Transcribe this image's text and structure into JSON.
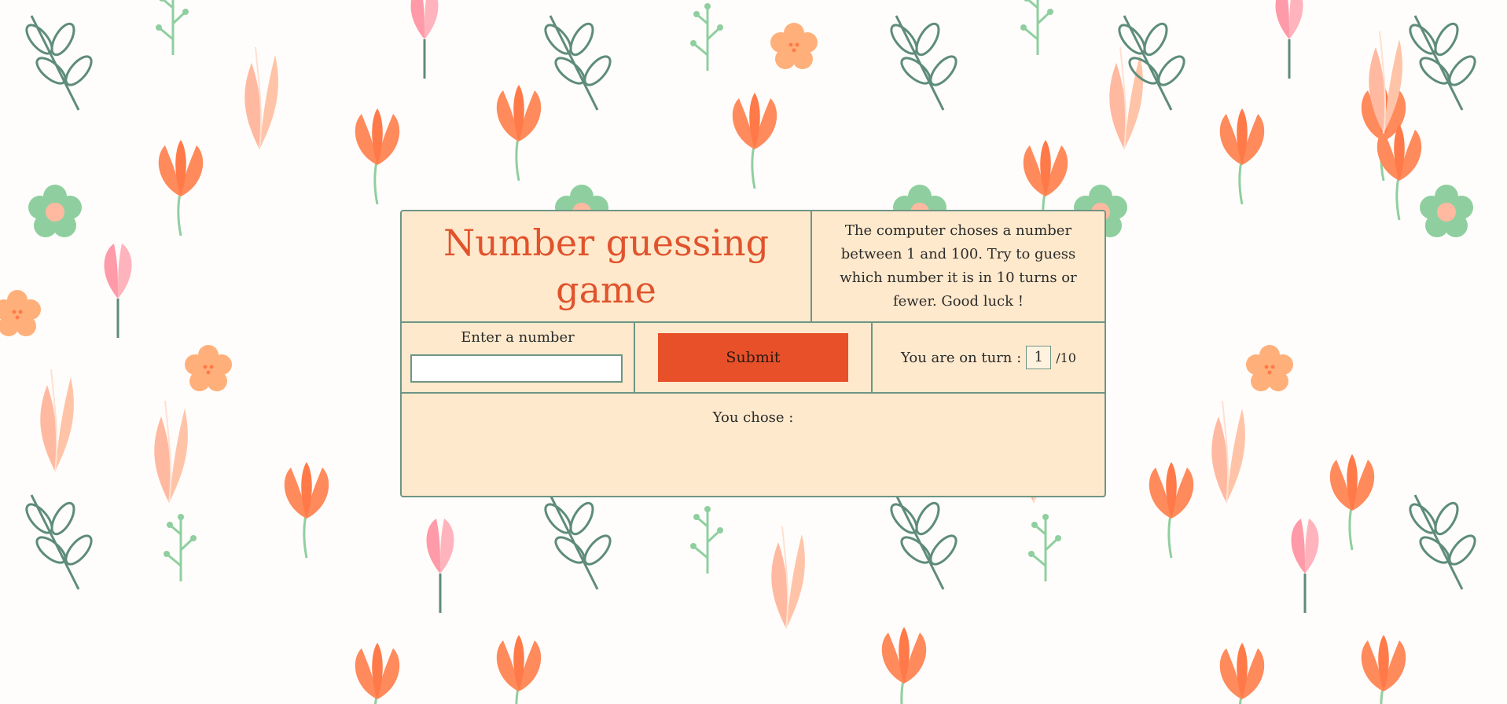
{
  "page": {
    "title": "Number guessing game",
    "description": "The computer choses a number between 1 and 100. Try to guess which number it is in 10 turns or fewer. Good luck !"
  },
  "guess": {
    "label": "Enter a number",
    "value": "",
    "placeholder": ""
  },
  "submit": {
    "label": "Submit"
  },
  "turn": {
    "prefix": "You are on turn :",
    "current": "1",
    "total": "/10"
  },
  "result": {
    "chose_label": "You chose :"
  },
  "colors": {
    "accent": "#e8502a",
    "title": "#e0532c",
    "panel": "#ffe9cc",
    "border": "#6e9585"
  },
  "background": {
    "pattern": "floral-pattern",
    "motifs": [
      "orange-tulip-icon",
      "green-leaf-icon",
      "pink-flower-icon",
      "peach-daisy-icon",
      "green-flower-icon"
    ]
  }
}
